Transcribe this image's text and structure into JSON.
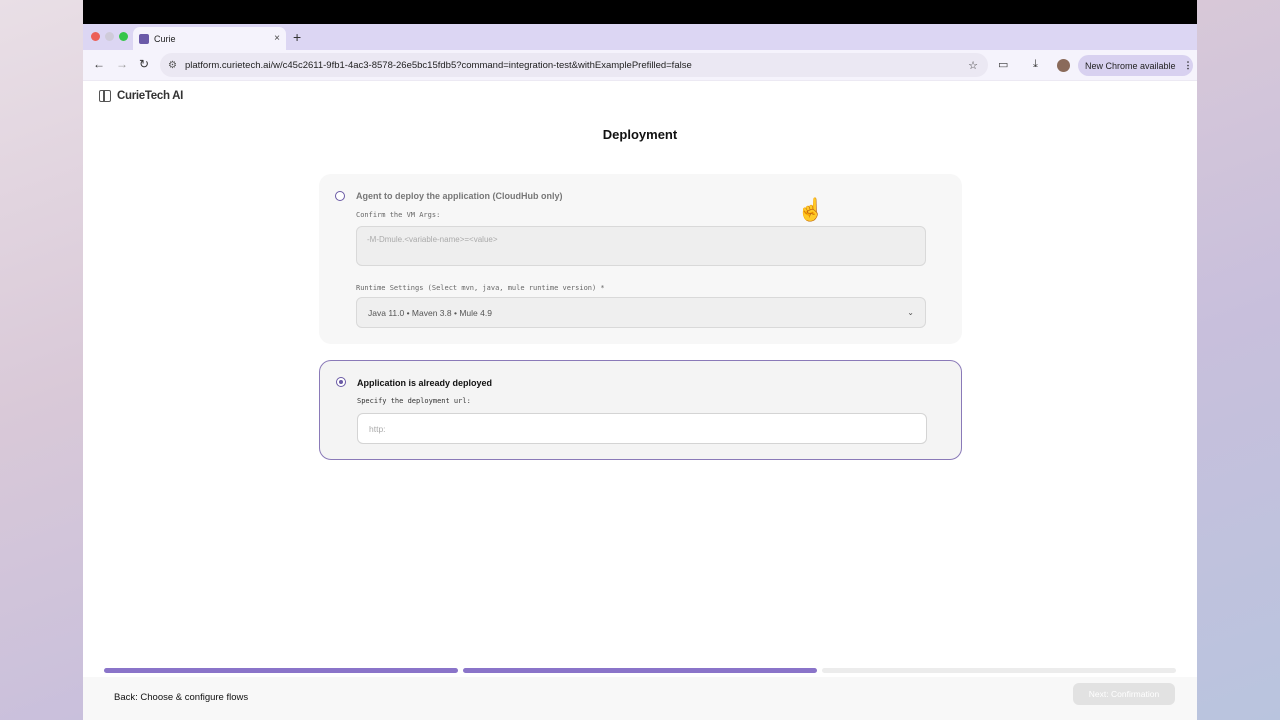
{
  "browser": {
    "tab_title": "Curie",
    "tab_close": "×",
    "new_tab": "+",
    "url": "platform.curietech.ai/w/c45c2611-9fb1-4ac3-8578-26e5bc15fdb5?command=integration-test&withExamplePrefilled=false",
    "update_label": "New Chrome available"
  },
  "brand": {
    "name": "CurieTech AI"
  },
  "page": {
    "title": "Deployment"
  },
  "option_agent": {
    "label": "Agent to deploy the application (CloudHub only)",
    "vm_args_label": "Confirm the VM Args:",
    "vm_args_placeholder": "-M-Dmule.<variable-name>=<value>",
    "runtime_label": "Runtime Settings (Select mvn, java, mule runtime version) *",
    "runtime_value": "Java 11.0 • Maven 3.8 • Mule 4.9"
  },
  "option_deployed": {
    "label": "Application is already deployed",
    "url_label": "Specify the deployment url:",
    "url_placeholder": "http:"
  },
  "progress": {
    "steps_total": 3,
    "steps_done": 2
  },
  "footer": {
    "back_label": "Back: Choose & configure flows",
    "next_label": "Next: Confirmation"
  },
  "icons": [
    "panel-icon",
    "back-arrow-icon",
    "forward-arrow-icon",
    "reload-icon",
    "tune-icon",
    "star-icon",
    "cast-icon",
    "download-icon",
    "profile-avatar",
    "more-icon",
    "chevron-down-icon",
    "hand-cursor-icon"
  ]
}
